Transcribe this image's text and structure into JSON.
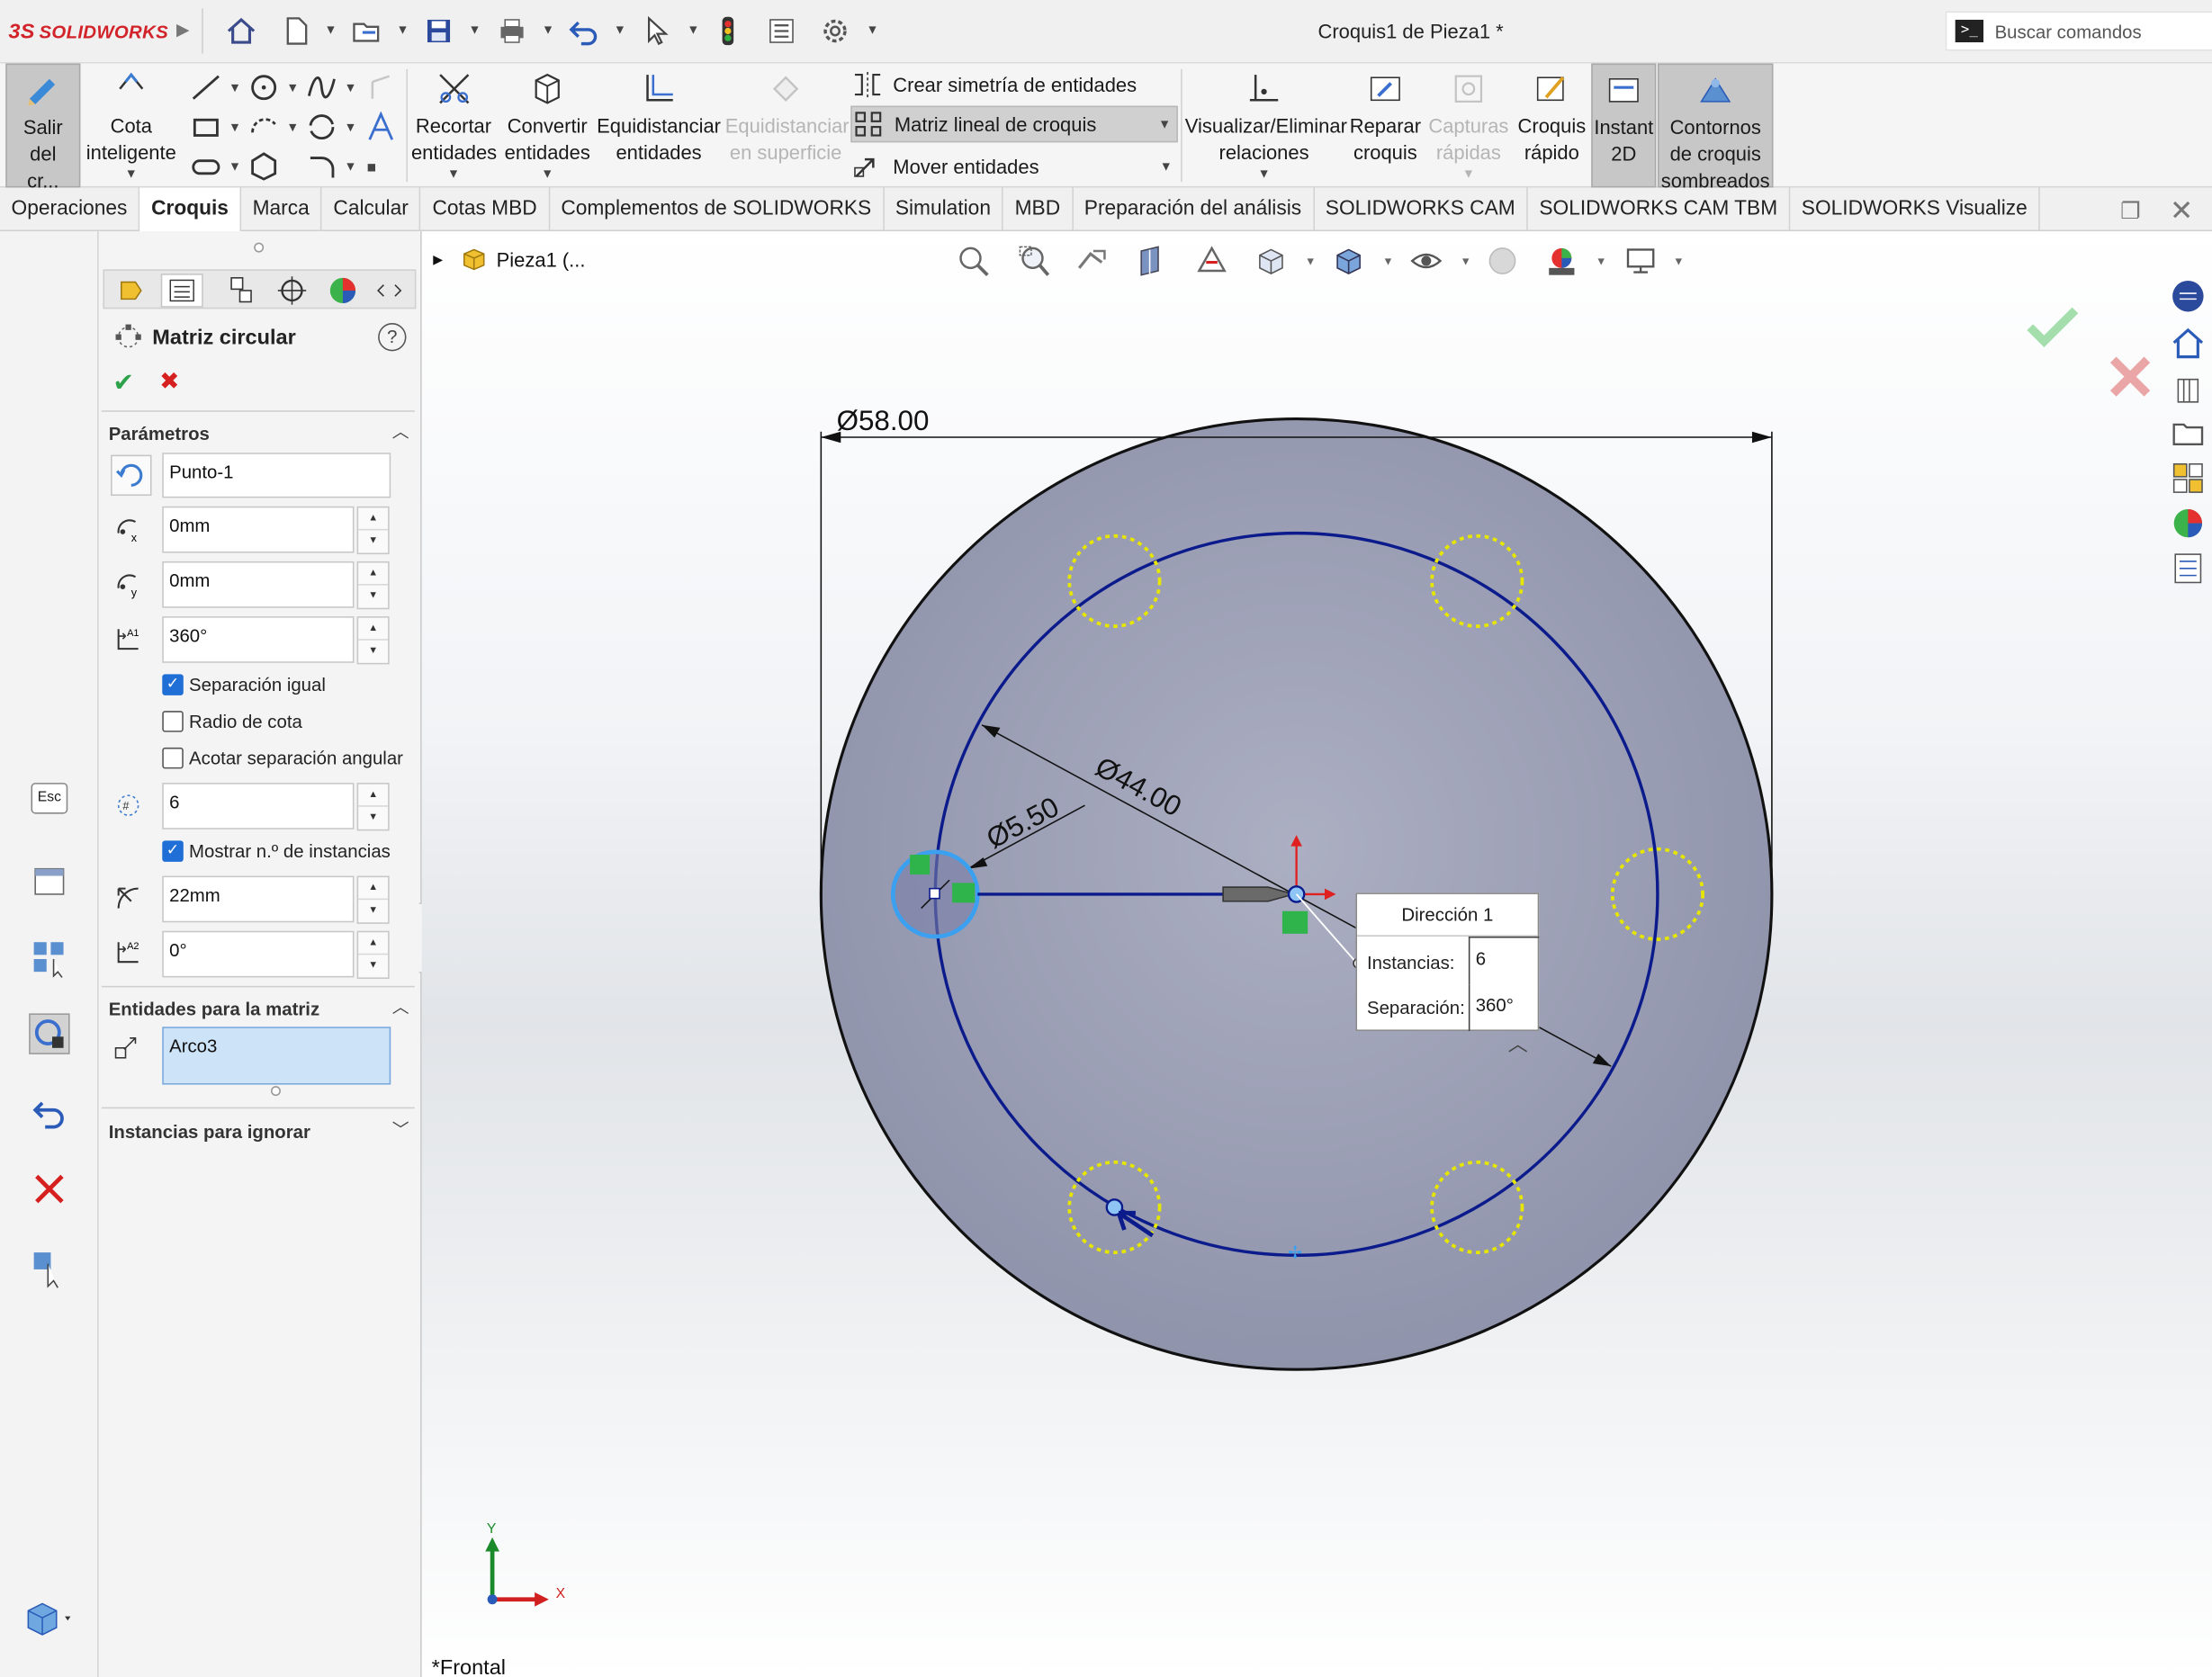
{
  "app": {
    "logo_prefix": "3S",
    "logo_text": "SOLIDWORKS",
    "document_title": "Croquis1 de Pieza1 *",
    "search_placeholder": "Buscar comandos"
  },
  "ribbon": {
    "exit_sketch": "Salir del cr...",
    "smart_dim": "Cota inteligente",
    "trim": "Recortar entidades",
    "convert": "Convertir entidades",
    "offset": "Equidistanciar entidades",
    "offset_surface": "Equidistanciar en superficie",
    "mirror": "Crear simetría de entidades",
    "linear_pattern": "Matriz lineal de croquis",
    "move": "Mover entidades",
    "relations": "Visualizar/Eliminar relaciones",
    "repair": "Reparar croquis",
    "quick_snaps": "Capturas rápidas",
    "rapid_sketch": "Croquis rápido",
    "instant2d": "Instant 2D",
    "shaded_contours": "Contornos de croquis sombreados"
  },
  "tabs": [
    "Operaciones",
    "Croquis",
    "Marca",
    "Calcular",
    "Cotas MBD",
    "Complementos de SOLIDWORKS",
    "Simulation",
    "MBD",
    "Preparación del análisis",
    "SOLIDWORKS CAM",
    "SOLIDWORKS CAM TBM",
    "SOLIDWORKS Visualize"
  ],
  "active_tab_index": 1,
  "left_strip": {
    "esc_label": "Esc"
  },
  "pm": {
    "title": "Matriz circular",
    "help": "?",
    "params_header": "Parámetros",
    "center": "Punto-1",
    "x": "0mm",
    "y": "0mm",
    "angle": "360°",
    "equal_spacing": "Separación igual",
    "dim_radius": "Radio de cota",
    "dim_angular": "Acotar separación angular",
    "instances": "6",
    "show_instances": "Mostrar n.º de instancias",
    "radius": "22mm",
    "arc_angle": "0°",
    "entities_header": "Entidades para la matriz",
    "entity": "Arco3",
    "skip_header": "Instancias para ignorar",
    "checks": {
      "equal_spacing": true,
      "dim_radius": false,
      "dim_angular": false,
      "show_instances": true
    }
  },
  "graphics": {
    "tree_root": "Pieza1 (...",
    "view_label": "*Frontal",
    "dim_outer": "Ø58.00",
    "dim_pitch": "Ø44.00",
    "dim_hole": "Ø5.50",
    "axis_x": "X",
    "axis_y": "Y",
    "popup": {
      "header": "Dirección 1",
      "instances_label": "Instancias:",
      "instances_value": "6",
      "spacing_label": "Separación:",
      "spacing_value": "360°"
    }
  },
  "colors": {
    "part_fill": "#9b9fb5",
    "sketch_blue": "#0b1b8c",
    "preview_yellow": "#e6e600",
    "brand_red": "#d2232a",
    "confirm_green": "#2ea24a",
    "cancel_red": "#d6201f"
  }
}
